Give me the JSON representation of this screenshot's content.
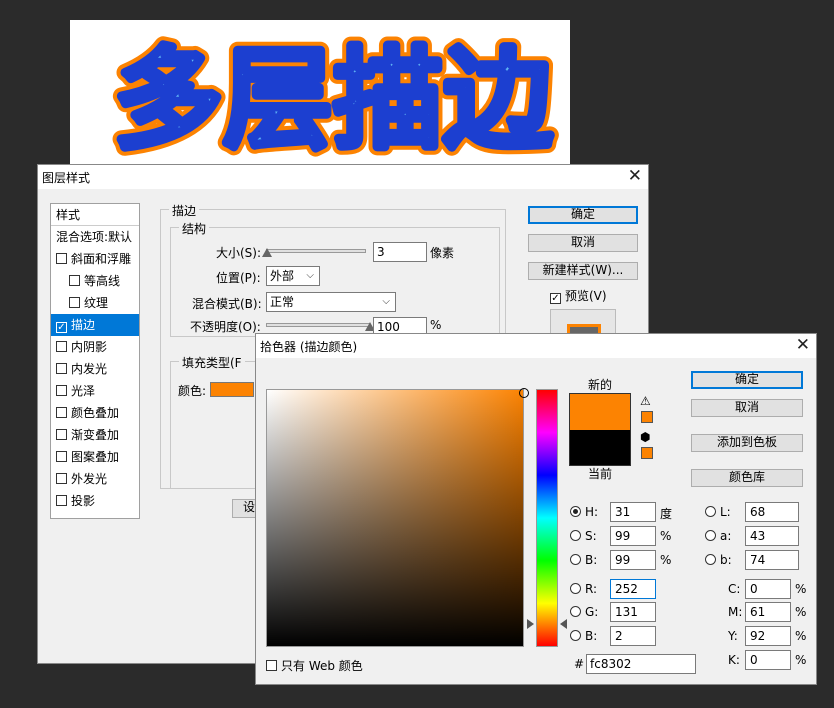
{
  "canvas": {
    "text": "多层描边",
    "fill": "#5fb5f5",
    "stroke_inner": "#1c3fd0",
    "stroke_outer": "#fc8302"
  },
  "layer_style": {
    "title": "图层样式",
    "list_header": "样式",
    "items": [
      {
        "label": "混合选项:默认",
        "checkbox": false,
        "sub": false,
        "active": false,
        "checked": false
      },
      {
        "label": "斜面和浮雕",
        "checkbox": true,
        "sub": false,
        "active": false,
        "checked": false
      },
      {
        "label": "等高线",
        "checkbox": true,
        "sub": true,
        "active": false,
        "checked": false
      },
      {
        "label": "纹理",
        "checkbox": true,
        "sub": true,
        "active": false,
        "checked": false
      },
      {
        "label": "描边",
        "checkbox": true,
        "sub": false,
        "active": true,
        "checked": true
      },
      {
        "label": "内阴影",
        "checkbox": true,
        "sub": false,
        "active": false,
        "checked": false
      },
      {
        "label": "内发光",
        "checkbox": true,
        "sub": false,
        "active": false,
        "checked": false
      },
      {
        "label": "光泽",
        "checkbox": true,
        "sub": false,
        "active": false,
        "checked": false
      },
      {
        "label": "颜色叠加",
        "checkbox": true,
        "sub": false,
        "active": false,
        "checked": false
      },
      {
        "label": "渐变叠加",
        "checkbox": true,
        "sub": false,
        "active": false,
        "checked": false
      },
      {
        "label": "图案叠加",
        "checkbox": true,
        "sub": false,
        "active": false,
        "checked": false
      },
      {
        "label": "外发光",
        "checkbox": true,
        "sub": false,
        "active": false,
        "checked": false
      },
      {
        "label": "投影",
        "checkbox": true,
        "sub": false,
        "active": false,
        "checked": false
      }
    ],
    "section_title": "描边",
    "structure_title": "结构",
    "size_label": "大小(S):",
    "size_value": "3",
    "size_unit": "像素",
    "size_fraction": 0.01,
    "position_label": "位置(P):",
    "position_value": "外部",
    "blend_label": "混合模式(B):",
    "blend_value": "正常",
    "opacity_label": "不透明度(O):",
    "opacity_value": "100",
    "opacity_unit": "%",
    "opacity_fraction": 1.0,
    "fill_type_label": "填充类型(F",
    "color_label": "颜色:",
    "color_value": "#fc8302",
    "set_button_partial": "设",
    "ok": "确定",
    "cancel": "取消",
    "new_style": "新建样式(W)...",
    "preview_label": "预览(V)",
    "preview_checked": true
  },
  "color_picker": {
    "title": "拾色器 (描边颜色)",
    "new_label": "新的",
    "current_label": "当前",
    "new_color": "#fc8302",
    "current_color": "#000000",
    "ok": "确定",
    "cancel": "取消",
    "add_swatch": "添加到色板",
    "color_lib": "颜色库",
    "hsb": [
      {
        "label": "H:",
        "value": "31",
        "unit": "度",
        "selected": true
      },
      {
        "label": "S:",
        "value": "99",
        "unit": "%",
        "selected": false
      },
      {
        "label": "B:",
        "value": "99",
        "unit": "%",
        "selected": false
      }
    ],
    "rgb": [
      {
        "label": "R:",
        "value": "252",
        "selected": false
      },
      {
        "label": "G:",
        "value": "131",
        "selected": false
      },
      {
        "label": "B:",
        "value": "2",
        "selected": false
      }
    ],
    "lab": [
      {
        "label": "L:",
        "value": "68",
        "selected": false
      },
      {
        "label": "a:",
        "value": "43",
        "selected": false
      },
      {
        "label": "b:",
        "value": "74",
        "selected": false
      }
    ],
    "cmyk": [
      {
        "label": "C:",
        "value": "0",
        "unit": "%"
      },
      {
        "label": "M:",
        "value": "61",
        "unit": "%"
      },
      {
        "label": "Y:",
        "value": "92",
        "unit": "%"
      },
      {
        "label": "K:",
        "value": "0",
        "unit": "%"
      }
    ],
    "hex_label": "#",
    "hex_value": "fc8302",
    "web_only_label": "只有 Web 颜色",
    "web_only_checked": false
  }
}
